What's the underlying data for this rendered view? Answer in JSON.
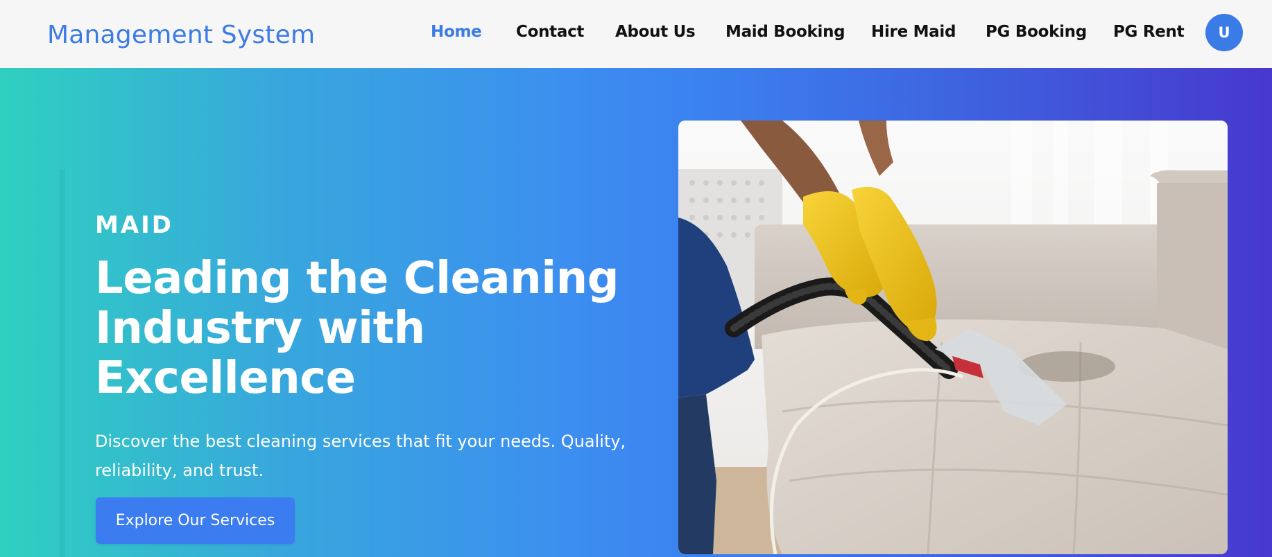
{
  "header": {
    "brand": "Management System",
    "nav": [
      {
        "label": "Home",
        "active": true
      },
      {
        "label": "Contact",
        "active": false
      },
      {
        "label": "About Us",
        "active": false
      },
      {
        "label": "Maid Booking",
        "active": false
      },
      {
        "label": "Hire Maid",
        "active": false
      },
      {
        "label": "PG Booking",
        "active": false
      },
      {
        "label": "PG Rent",
        "active": false
      }
    ],
    "avatar_initial": "U"
  },
  "hero": {
    "eyebrow": "MAID",
    "headline": "Leading the Cleaning Industry with Excellence",
    "subtext": "Discover the best cleaning services that fit your needs. Quality, reliability, and trust.",
    "cta_label": "Explore Our Services",
    "image_subject": "maid-vacuuming-sofa-photo"
  },
  "colors": {
    "brand_blue": "#3b7be6",
    "header_bg": "#f6f6f6",
    "gradient_start": "#2fd0c0",
    "gradient_mid": "#3c8ef0",
    "gradient_end": "#4738ce",
    "glove_yellow": "#f2c318"
  }
}
